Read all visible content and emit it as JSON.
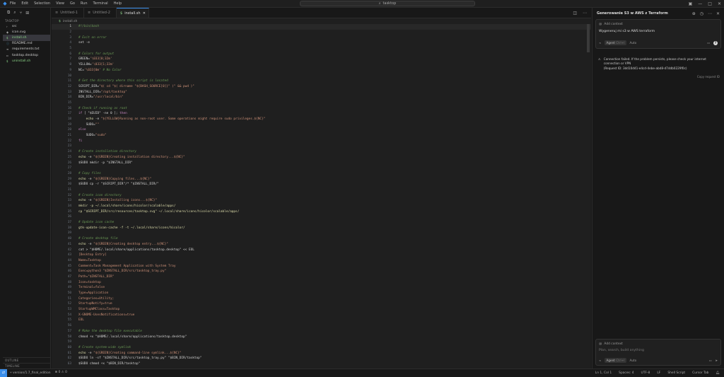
{
  "menu": [
    "File",
    "Edit",
    "Selection",
    "View",
    "Go",
    "Run",
    "Terminal",
    "Help"
  ],
  "search": {
    "label": "tasktop"
  },
  "sidebar": {
    "section": "TASKTOP",
    "files": [
      {
        "name": "src",
        "icon": "›",
        "sel": false
      },
      {
        "name": "icon.svg",
        "icon": "◈",
        "sel": false
      },
      {
        "name": "install.sh",
        "icon": "$",
        "sel": true
      },
      {
        "name": "README.md",
        "icon": "ⓘ",
        "sel": false
      },
      {
        "name": "requirements.txt",
        "icon": "≡",
        "sel": false
      },
      {
        "name": "tasktop.desktop",
        "icon": "▫",
        "sel": false
      },
      {
        "name": "uninstall.sh",
        "icon": "$",
        "sel": false
      }
    ],
    "bottom": [
      "OUTLINE",
      "TIMELINE"
    ]
  },
  "tabs": [
    {
      "label": "Untitled-1",
      "active": false
    },
    {
      "label": "Untitled-2",
      "active": false
    },
    {
      "label": "install.sh",
      "active": true
    }
  ],
  "breadcrumb": "install.sh",
  "code": [
    [
      [
        "#!/bin/bash",
        "comment"
      ]
    ],
    [
      [
        "",
        ""
      ]
    ],
    [
      [
        "# Exit on error",
        "comment"
      ]
    ],
    [
      [
        "set -e",
        "plain"
      ]
    ],
    [
      [
        "",
        ""
      ]
    ],
    [
      [
        "# Colors for output",
        "comment"
      ]
    ],
    [
      [
        "GREEN=",
        "plain"
      ],
      [
        "'\\033[0;32m'",
        "str"
      ]
    ],
    [
      [
        "YELLOW=",
        "plain"
      ],
      [
        "'\\033[1;33m'",
        "str"
      ]
    ],
    [
      [
        "NC=",
        "plain"
      ],
      [
        "'\\033[0m'",
        "str"
      ],
      [
        " # No Color",
        "comment"
      ]
    ],
    [
      [
        "",
        ""
      ]
    ],
    [
      [
        "# Get the directory where this script is located",
        "comment"
      ]
    ],
    [
      [
        "SCRIPT_DIR=",
        "plain"
      ],
      [
        "\"$( cd \"$( dirname \"${BASH_SOURCE[0]}\" )\" && pwd )\"",
        "str"
      ]
    ],
    [
      [
        "INSTALL_DIR=",
        "plain"
      ],
      [
        "\"/opt/tasktop\"",
        "str"
      ]
    ],
    [
      [
        "BIN_DIR=",
        "plain"
      ],
      [
        "\"/usr/local/bin\"",
        "str"
      ]
    ],
    [
      [
        "",
        ""
      ]
    ],
    [
      [
        "# Check if running as root",
        "comment"
      ]
    ],
    [
      [
        "if",
        "kw"
      ],
      [
        " [ \"$EUID\" -ne 0 ]; ",
        "plain"
      ],
      [
        "then",
        "kw"
      ]
    ],
    [
      [
        "    echo",
        "cmd"
      ],
      [
        " -e ",
        "plain"
      ],
      [
        "\"${YELLOW}Running as non-root user. Some operations might require sudo privileges.${NC}\"",
        "str"
      ]
    ],
    [
      [
        "    SUDO=",
        "plain"
      ],
      [
        "\"\"",
        "str"
      ]
    ],
    [
      [
        "else",
        "kw"
      ]
    ],
    [
      [
        "    SUDO=",
        "plain"
      ],
      [
        "\"sudo\"",
        "str"
      ]
    ],
    [
      [
        "fi",
        "kw"
      ]
    ],
    [
      [
        "",
        ""
      ]
    ],
    [
      [
        "# Create installation directory",
        "comment"
      ]
    ],
    [
      [
        "echo",
        "cmd"
      ],
      [
        " -e ",
        "plain"
      ],
      [
        "\"${GREEN}Creating installation directory...${NC}\"",
        "str"
      ]
    ],
    [
      [
        "$SUDO mkdir -p \"$INSTALL_DIR\"",
        "plain"
      ]
    ],
    [
      [
        "",
        ""
      ]
    ],
    [
      [
        "# Copy files",
        "comment"
      ]
    ],
    [
      [
        "echo",
        "cmd"
      ],
      [
        " -e ",
        "plain"
      ],
      [
        "\"${GREEN}Copying files...${NC}\"",
        "str"
      ]
    ],
    [
      [
        "$SUDO cp -r \"$SCRIPT_DIR\"/* \"$INSTALL_DIR/\"",
        "plain"
      ]
    ],
    [
      [
        "",
        ""
      ]
    ],
    [
      [
        "# Create icon directory",
        "comment"
      ]
    ],
    [
      [
        "echo",
        "cmd"
      ],
      [
        " -e ",
        "plain"
      ],
      [
        "\"${GREEN}Installing icons...${NC}\"",
        "str"
      ]
    ],
    [
      [
        "mkdir -p ~/.local/share/icons/hicolor/scalable/apps/",
        "cmd"
      ]
    ],
    [
      [
        "cp \"$SCRIPT_DIR/src/resources/tasktop.svg\" ~/.local/share/icons/hicolor/scalable/apps/",
        "cmd"
      ]
    ],
    [
      [
        "",
        ""
      ]
    ],
    [
      [
        "# Update icon cache",
        "comment"
      ]
    ],
    [
      [
        "gtk-update-icon-cache -f -t ~/.local/share/icons/hicolor/",
        "cmd"
      ]
    ],
    [
      [
        "",
        ""
      ]
    ],
    [
      [
        "# Create desktop file",
        "comment"
      ]
    ],
    [
      [
        "echo",
        "cmd"
      ],
      [
        " -e ",
        "plain"
      ],
      [
        "\"${GREEN}Creating desktop entry...${NC}\"",
        "str"
      ]
    ],
    [
      [
        "cat > \"$HOME/.local/share/applications/tasktop.desktop\" << EOL",
        "plain"
      ]
    ],
    [
      [
        "[Desktop Entry]",
        "str"
      ]
    ],
    [
      [
        "Name=Tasktop",
        "str"
      ]
    ],
    [
      [
        "Comment=Task Management Application with System Tray",
        "str"
      ]
    ],
    [
      [
        "Exec=python3 \"$INSTALL_DIR/src/tasktop_tray.py\"",
        "str"
      ]
    ],
    [
      [
        "Path=\"$INSTALL_DIR\"",
        "str"
      ]
    ],
    [
      [
        "Icon=tasktop",
        "str"
      ]
    ],
    [
      [
        "Terminal=false",
        "str"
      ]
    ],
    [
      [
        "Type=Application",
        "str"
      ]
    ],
    [
      [
        "Categories=Utility;",
        "str"
      ]
    ],
    [
      [
        "StartupNotify=true",
        "str"
      ]
    ],
    [
      [
        "StartupWMClass=Tasktop",
        "str"
      ]
    ],
    [
      [
        "X-GNOME-UsesNotifications=true",
        "str"
      ]
    ],
    [
      [
        "EOL",
        "str"
      ]
    ],
    [
      [
        "",
        ""
      ]
    ],
    [
      [
        "# Make the desktop file executable",
        "comment"
      ]
    ],
    [
      [
        "chmod +x \"$HOME/.local/share/applications/tasktop.desktop\"",
        "plain"
      ]
    ],
    [
      [
        "",
        ""
      ]
    ],
    [
      [
        "# Create system-wide symlink",
        "comment"
      ]
    ],
    [
      [
        "echo",
        "cmd"
      ],
      [
        " -e ",
        "plain"
      ],
      [
        "\"${GREEN}Creating command-line symlink...${NC}\"",
        "str"
      ]
    ],
    [
      [
        "$SUDO ln -sf \"$INSTALL_DIR/src/tasktop_tray.py\" \"$BIN_DIR/tasktop\"",
        "plain"
      ]
    ],
    [
      [
        "$SUDO chmod +x \"$BIN_DIR/tasktop\"",
        "plain"
      ]
    ]
  ],
  "chat": {
    "title": "Generowanie S3 w AWS z Terraform",
    "add_context": "Add context",
    "message": "Wygeneruj mi s3 w AWS terraform",
    "agent": "Agent",
    "agent_key": "Ctrl+I",
    "auto": "Auto",
    "error_l1": "Connection failed. If the problem persists, please check your internet connection or VPN",
    "error_l2": "(Request ID: 3dd10d41-e4cd-4ebe-abd8-d7ddb0229f0c)",
    "copy_request": "Copy request ID",
    "input_placeholder": "Plan, search, build anything"
  },
  "status": {
    "branch": "version/1.7_final_edition",
    "problems": "⊗ 0 ⚠ 0",
    "ln_col": "Ln 1, Col 1",
    "spaces": "Spaces: 4",
    "encoding": "UTF-8",
    "eol": "LF",
    "lang": "Shell Script",
    "cursor_tab": "Cursor Tab"
  }
}
